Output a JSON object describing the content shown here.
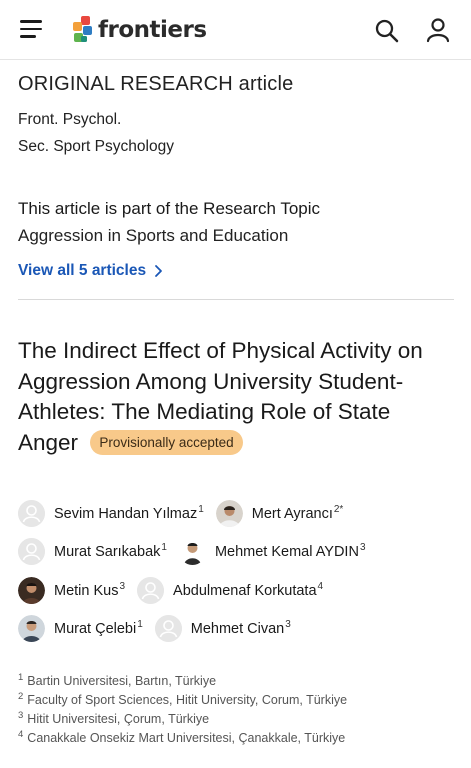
{
  "header": {
    "logo_text": "frontiers",
    "icons": [
      "menu-icon",
      "frontiers-logo",
      "search-icon",
      "user-icon"
    ]
  },
  "article": {
    "type": "ORIGINAL RESEARCH article",
    "journal": "Front. Psychol.",
    "section": "Sec. Sport Psychology",
    "topic_intro": "This article is part of the Research Topic",
    "topic_name": "Aggression in Sports and Education",
    "view_all": "View all 5 articles",
    "title": "The Indirect Effect of Physical Activity on Aggression Among University Student-Athletes: The Mediating Role of State Anger",
    "badge": "Provisionally accepted"
  },
  "authors": [
    {
      "name": "Sevim Handan Yılmaz",
      "sup": "1"
    },
    {
      "name": "Mert Ayrancı",
      "sup": "2*"
    },
    {
      "name": "Murat Sarıkabak",
      "sup": "1"
    },
    {
      "name": "Mehmet Kemal AYDIN",
      "sup": "3"
    },
    {
      "name": "Metin Kus",
      "sup": "3"
    },
    {
      "name": "Abdulmenaf Korkutata",
      "sup": "4"
    },
    {
      "name": "Murat Çelebi",
      "sup": "1"
    },
    {
      "name": "Mehmet Civan",
      "sup": "3"
    }
  ],
  "affiliations": [
    {
      "num": "1",
      "text": "Bartin Universitesi, Bartın, Türkiye"
    },
    {
      "num": "2",
      "text": "Faculty of Sport Sciences, Hitit University, Corum, Türkiye"
    },
    {
      "num": "3",
      "text": "Hitit Universitesi, Çorum, Türkiye"
    },
    {
      "num": "4",
      "text": "Canakkale Onsekiz Mart Universitesi, Çanakkale, Türkiye"
    }
  ],
  "colors": {
    "link": "#1a57b6",
    "badge_bg": "#f8c98a",
    "logo_red": "#e9483f",
    "logo_orange": "#f3a03b",
    "logo_green": "#5fb44e",
    "logo_blue": "#2f7dc3"
  }
}
